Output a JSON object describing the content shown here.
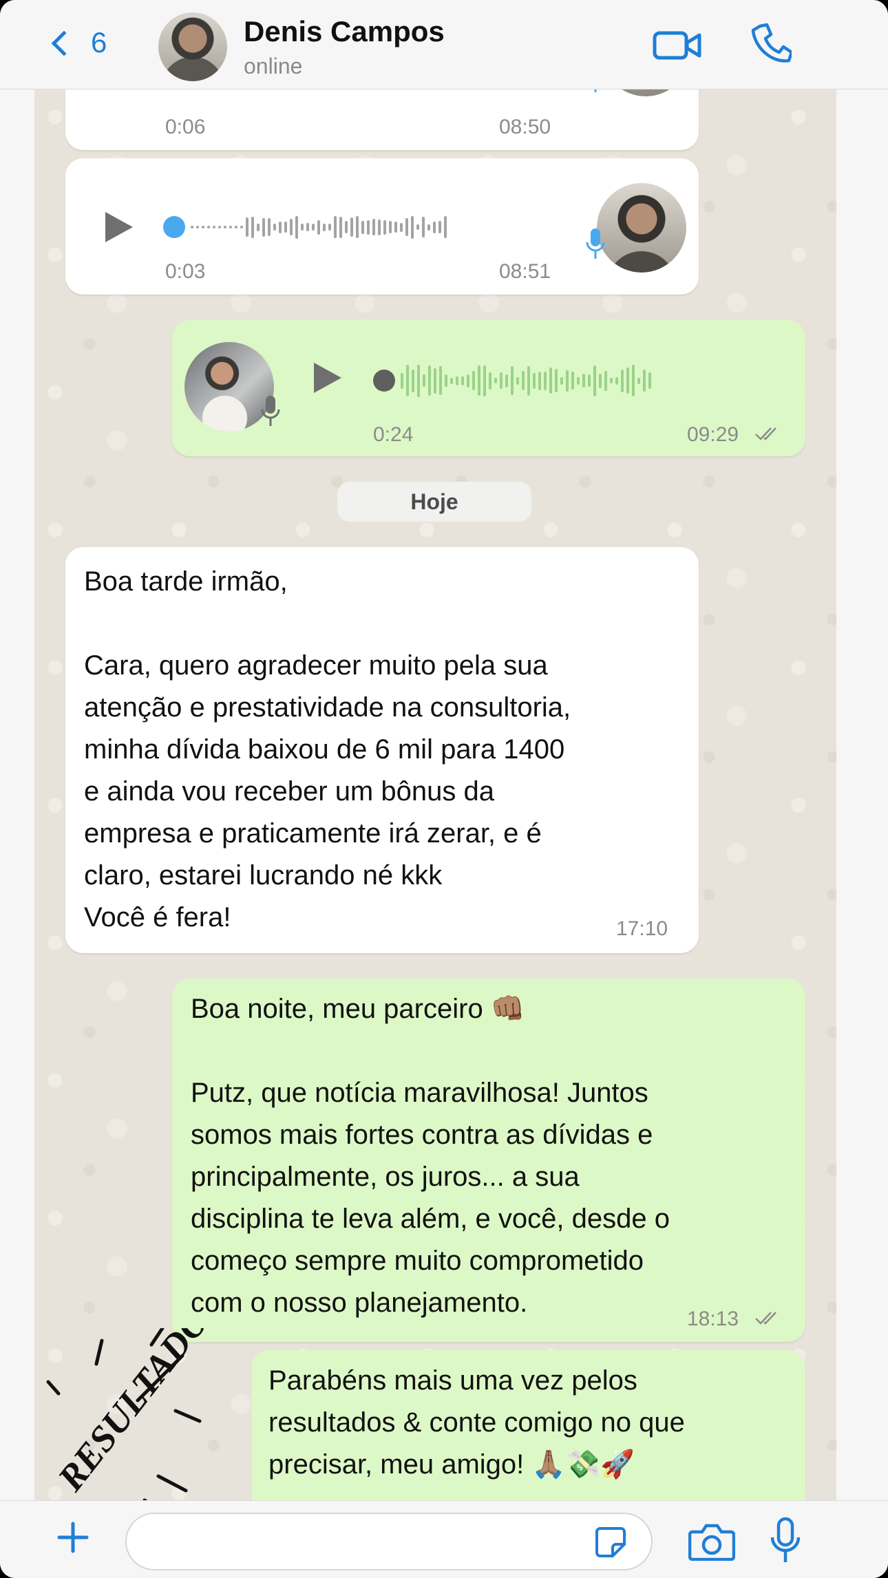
{
  "header": {
    "back_count": "6",
    "contact_name": "Denis Campos",
    "contact_status": "online"
  },
  "voice_messages": [
    {
      "direction": "incoming",
      "duration": "0:06",
      "time": "08:50"
    },
    {
      "direction": "incoming",
      "duration": "0:03",
      "time": "08:51"
    },
    {
      "direction": "outgoing",
      "duration": "0:24",
      "time": "09:29",
      "read": true
    }
  ],
  "date_divider": "Hoje",
  "messages": [
    {
      "direction": "incoming",
      "text": "Boa tarde irmão,\n\nCara, quero agradecer muito pela sua\natenção e prestatividade na consultoria,\nminha dívida baixou de 6 mil para 1400\ne ainda vou receber um bônus da\nempresa e praticamente irá zerar, e é\nclaro, estarei lucrando né kkk\nVocê é fera!",
      "time": "17:10"
    },
    {
      "direction": "outgoing",
      "text": "Boa noite, meu parceiro 👊🏽\n\nPutz, que notícia maravilhosa! Juntos\nsomos mais fortes contra as dívidas e\nprincipalmente, os juros... a sua\ndisciplina te leva além, e você, desde o\ncomeço sempre muito comprometido\ncom o nosso planejamento.",
      "time": "18:13",
      "read": true
    },
    {
      "direction": "outgoing",
      "text": "Parabéns mais uma vez pelos\nresultados & conte comigo no que\nprecisar, meu amigo! 🙏🏽💸🚀"
    }
  ],
  "stamp_text": "RESULTADOS",
  "colors": {
    "accent": "#1f7ed6",
    "outgoing_bubble": "#dcf8c6",
    "incoming_bubble": "#ffffff",
    "voice_knob_incoming": "#4aa8ee",
    "chat_background": "#e8e3da"
  },
  "icons": [
    "chevron-left-icon",
    "video-camera-icon",
    "phone-icon",
    "play-icon",
    "microphone-icon",
    "double-check-icon",
    "plus-icon",
    "sticker-icon",
    "camera-icon"
  ]
}
